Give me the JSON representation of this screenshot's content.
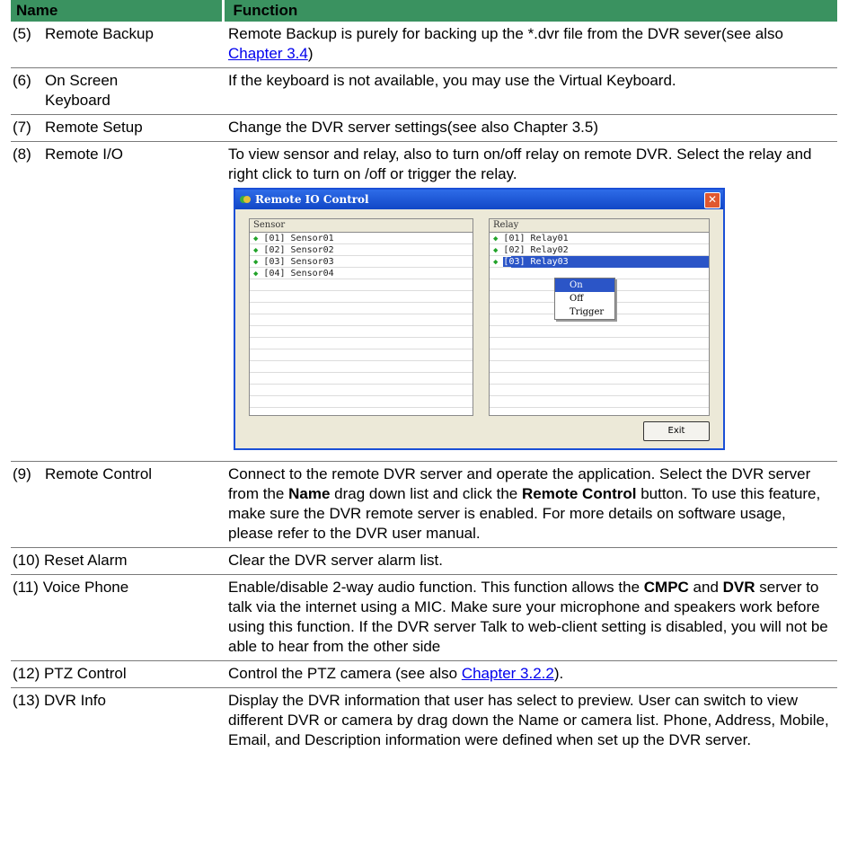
{
  "table": {
    "headers": {
      "name": "Name",
      "function": "Function"
    },
    "rows": [
      {
        "num": "(5)",
        "name": "Remote Backup",
        "text": "Remote Backup is purely for backing up the *.dvr file from the DVR sever(see also ",
        "link": "Chapter 3.4",
        "after": ")"
      },
      {
        "num": "(6)",
        "name": "On Screen",
        "name2": "Keyboard",
        "text": "If the keyboard is not available, you may use the Virtual Keyboard."
      },
      {
        "num": "(7)",
        "name": "Remote Setup",
        "text": "Change the DVR server settings(see also Chapter 3.5)"
      },
      {
        "num": "(8)",
        "name": "Remote I/O",
        "text": "To view sensor and relay, also to turn on/off relay on remote DVR. Select the relay and right click to turn on /off or trigger the relay."
      },
      {
        "num": "(9)",
        "name": "Remote Control",
        "t1": "Connect to the remote DVR server and operate the application. Select the DVR server from the ",
        "b1": "Name",
        "t2": " drag down list and click the ",
        "b2": "Remote Control",
        "t3": " button. To use this feature, make sure the DVR remote server is enabled. For more details on software usage, please refer to the DVR user manual."
      },
      {
        "num": "(10)",
        "name": "Reset Alarm",
        "text": "Clear the DVR server alarm list."
      },
      {
        "num": "(11)",
        "name": "Voice Phone",
        "t1": "Enable/disable 2-way audio function. This function allows the ",
        "b1": "CMPC",
        "t2": " and ",
        "b2": "DVR",
        "t3": " server to talk via the internet using a MIC.  Make sure your microphone and speakers work before using this function. If the DVR server Talk to web-client setting is disabled, you will not be able to hear from the other side"
      },
      {
        "num": "(12)",
        "name": "PTZ Control",
        "text": "Control the PTZ camera (see also ",
        "link": "Chapter 3.2.2",
        "after": ")."
      },
      {
        "num": "(13)",
        "name": "DVR Info",
        "text": "Display the DVR information that user has select to preview. User can switch to view different DVR or camera by drag down the Name or camera list. Phone, Address, Mobile, Email, and Description information were defined when set up the DVR server."
      }
    ]
  },
  "dialog": {
    "title": "Remote IO Control",
    "sensor_header": "Sensor",
    "relay_header": "Relay",
    "sensors": [
      "[01] Sensor01",
      "[02] Sensor02",
      "[03] Sensor03",
      "[04] Sensor04"
    ],
    "relays": [
      "[01] Relay01",
      "[02] Relay02",
      "[03] Relay03"
    ],
    "menu": [
      "On",
      "Off",
      "Trigger"
    ],
    "exit_label": "Exit",
    "status_color": "#22a32a",
    "selection_color": "#2b55c7"
  }
}
